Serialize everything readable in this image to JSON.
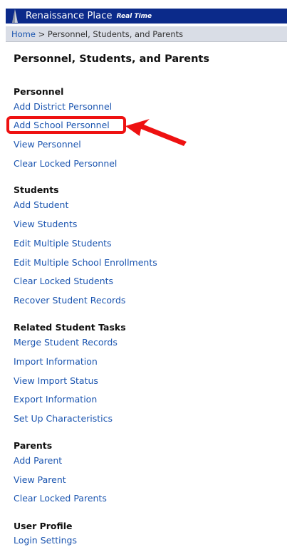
{
  "header": {
    "brand": "Renaissance Place",
    "brand_sub": "Real Time"
  },
  "breadcrumb": {
    "home": "Home",
    "separator": " > ",
    "current": "Personnel, Students, and Parents"
  },
  "page_title": "Personnel, Students, and Parents",
  "sections": {
    "personnel": {
      "title": "Personnel",
      "links": [
        "Add District Personnel",
        "Add School Personnel",
        "View Personnel",
        "Clear Locked Personnel"
      ]
    },
    "students": {
      "title": "Students",
      "links": [
        "Add Student",
        "View Students",
        "Edit Multiple Students",
        "Edit Multiple School Enrollments",
        "Clear Locked Students",
        "Recover Student Records"
      ]
    },
    "related": {
      "title": "Related Student Tasks",
      "links": [
        "Merge Student Records",
        "Import Information",
        "View Import Status",
        "Export Information",
        "Set Up Characteristics"
      ]
    },
    "parents": {
      "title": "Parents",
      "links": [
        "Add Parent",
        "View Parent",
        "Clear Locked Parents"
      ]
    },
    "profile": {
      "title": "User Profile",
      "links": [
        "Login Settings"
      ]
    }
  },
  "annotation": {
    "color": "#ee1111"
  }
}
